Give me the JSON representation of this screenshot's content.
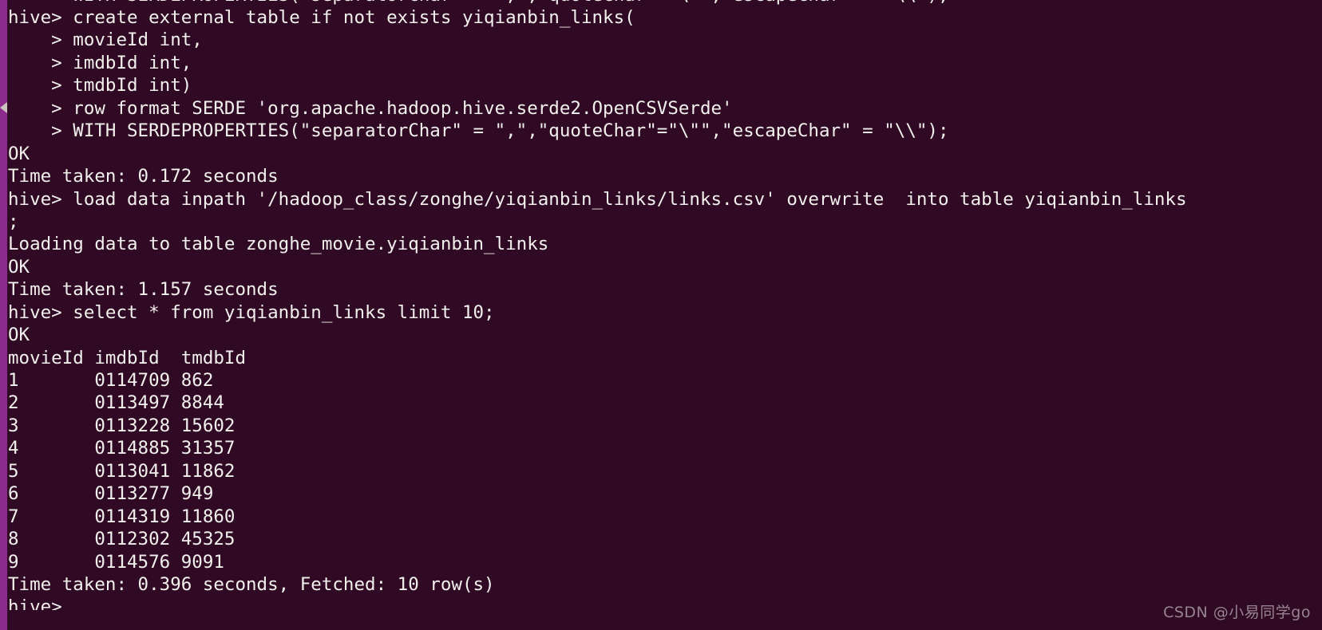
{
  "terminal": {
    "shell": "hive",
    "prompt": "hive>",
    "continuation_prompt": "    >",
    "background_color": "#300a24",
    "foreground_color": "#f2f0ec",
    "scrollbar_color": "#8d2a8d",
    "partial_top_line": "    > WITH SERDEPROPERTIES(\"separatorChar\" = \",\",\"quoteChar\"=\"\\\"\",\"escapeChar\" = \"\\\\\");",
    "partial_bottom_line": "hive>",
    "lines": [
      "hive> create external table if not exists yiqianbin_links(",
      "    > movieId int,",
      "    > imdbId int,",
      "    > tmdbId int)",
      "    > row format SERDE 'org.apache.hadoop.hive.serde2.OpenCSVSerde'",
      "    > WITH SERDEPROPERTIES(\"separatorChar\" = \",\",\"quoteChar\"=\"\\\"\",\"escapeChar\" = \"\\\\\");",
      "OK",
      "Time taken: 0.172 seconds",
      "hive> load data inpath '/hadoop_class/zonghe/yiqianbin_links/links.csv' overwrite  into table yiqianbin_links",
      ";",
      "Loading data to table zonghe_movie.yiqianbin_links",
      "OK",
      "Time taken: 1.157 seconds",
      "hive> select * from yiqianbin_links limit 10;",
      "OK",
      "movieId imdbId  tmdbId",
      "1       0114709 862",
      "2       0113497 8844",
      "3       0113228 15602",
      "4       0114885 31357",
      "5       0113041 11862",
      "6       0113277 949",
      "7       0114319 11860",
      "8       0112302 45325",
      "9       0114576 9091",
      "Time taken: 0.396 seconds, Fetched: 10 row(s)"
    ],
    "commands": [
      {
        "prompt": "hive>",
        "statement": "create external table if not exists yiqianbin_links( movieId int, imdbId int, tmdbId int) row format SERDE 'org.apache.hadoop.hive.serde2.OpenCSVSerde' WITH SERDEPROPERTIES(\"separatorChar\" = \",\",\"quoteChar\"=\"\\\"\",\"escapeChar\" = \"\\\\\");",
        "result": "OK",
        "time_taken": "Time taken: 0.172 seconds"
      },
      {
        "prompt": "hive>",
        "statement": "load data inpath '/hadoop_class/zonghe/yiqianbin_links/links.csv' overwrite  into table yiqianbin_links;",
        "result": "OK",
        "status": "Loading data to table zonghe_movie.yiqianbin_links",
        "time_taken": "Time taken: 1.157 seconds"
      },
      {
        "prompt": "hive>",
        "statement": "select * from yiqianbin_links limit 10;",
        "result": "OK",
        "time_taken": "Time taken: 0.396 seconds, Fetched: 10 row(s)"
      }
    ],
    "query_result": {
      "columns": [
        "movieId",
        "imdbId",
        "tmdbId"
      ],
      "rows": [
        [
          "1",
          "0114709",
          "862"
        ],
        [
          "2",
          "0113497",
          "8844"
        ],
        [
          "3",
          "0113228",
          "15602"
        ],
        [
          "4",
          "0114885",
          "31357"
        ],
        [
          "5",
          "0113041",
          "11862"
        ],
        [
          "6",
          "0113277",
          "949"
        ],
        [
          "7",
          "0114319",
          "11860"
        ],
        [
          "8",
          "0112302",
          "45325"
        ],
        [
          "9",
          "0114576",
          "9091"
        ]
      ],
      "fetched_count": "10"
    }
  },
  "watermark": {
    "text": "CSDN @小易同学go"
  }
}
